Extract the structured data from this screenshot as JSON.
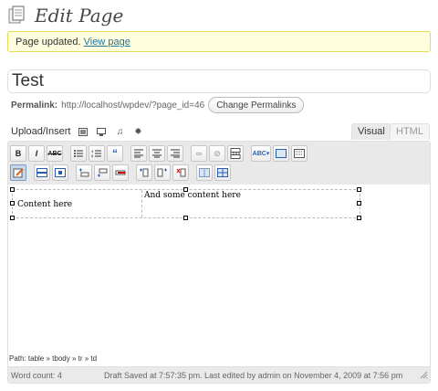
{
  "header": {
    "title": "Edit Page"
  },
  "notice": {
    "text": "Page updated.",
    "link": "View page"
  },
  "post": {
    "title": "Test"
  },
  "permalink": {
    "label": "Permalink:",
    "url": "http://localhost/wpdev/?page_id=46",
    "button": "Change Permalinks"
  },
  "media": {
    "label": "Upload/Insert"
  },
  "tabs": {
    "visual": "Visual",
    "html": "HTML"
  },
  "editor": {
    "cell1": "Content here",
    "cell2": "And some content here",
    "path": "Path: table » tbody » tr » td",
    "word_count": "Word count: 4",
    "status": "Draft Saved at 7:57:35 pm. Last edited by admin on November 4, 2009 at 7:56 pm"
  },
  "toolbar": {
    "row1": [
      "bold-icon",
      "italic-icon",
      "strikethrough-icon",
      "bullet-list-icon",
      "numbered-list-icon",
      "blockquote-icon",
      "align-left-icon",
      "align-center-icon",
      "align-right-icon",
      "link-icon",
      "unlink-icon",
      "more-tag-icon",
      "spellcheck-icon",
      "fullscreen-icon",
      "kitchen-sink-icon"
    ],
    "row2": [
      "edit-table-icon",
      "row-properties-icon",
      "cell-properties-icon",
      "insert-row-before-icon",
      "insert-row-after-icon",
      "delete-row-icon",
      "insert-col-before-icon",
      "insert-col-after-icon",
      "delete-col-icon",
      "split-cells-icon",
      "merge-cells-icon"
    ]
  },
  "colors": {
    "accent": "#21759b",
    "notice_bg": "#ffffe0",
    "notice_border": "#e6db55"
  }
}
